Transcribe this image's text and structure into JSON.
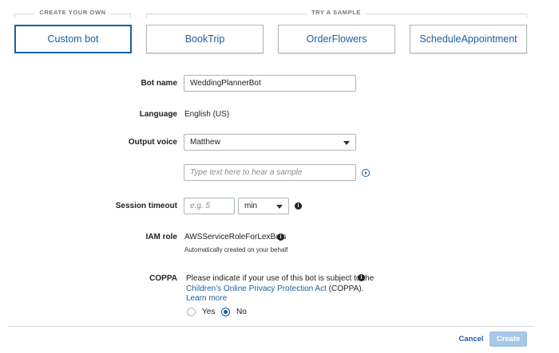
{
  "groups": {
    "create_own": "CREATE YOUR OWN",
    "try_sample": "TRY A SAMPLE"
  },
  "tiles": [
    {
      "label": "Custom bot",
      "selected": true
    },
    {
      "label": "BookTrip",
      "selected": false
    },
    {
      "label": "OrderFlowers",
      "selected": false
    },
    {
      "label": "ScheduleAppointment",
      "selected": false
    }
  ],
  "form": {
    "bot_name": {
      "label": "Bot name",
      "value": "WeddingPlannerBot"
    },
    "language": {
      "label": "Language",
      "value": "English (US)"
    },
    "output_voice": {
      "label": "Output voice",
      "value": "Matthew"
    },
    "sample_text": {
      "placeholder": "Type text here to hear a sample"
    },
    "session_timeout": {
      "label": "Session timeout",
      "placeholder": "e.g. 5",
      "unit": "min"
    },
    "iam_role": {
      "label": "IAM role",
      "value": "AWSServiceRoleForLexBots",
      "note": "Automatically created on your behalf"
    },
    "coppa": {
      "label": "COPPA",
      "text_1": "Please indicate if your use of this bot is subject to the",
      "link": "Children's Online Privacy Protection Act",
      "text_2": "(COPPA).",
      "learn_more": "Learn more",
      "options": [
        {
          "label": "Yes",
          "selected": false
        },
        {
          "label": "No",
          "selected": true
        }
      ]
    }
  },
  "footer": {
    "cancel": "Cancel",
    "create": "Create"
  },
  "icons": {
    "info": "info-icon",
    "play": "play-icon",
    "dropdown": "chevron-down-icon"
  },
  "colors": {
    "accent": "#1a5f9e",
    "border": "#aab7b8",
    "disabled_button": "#a9c7e8"
  }
}
